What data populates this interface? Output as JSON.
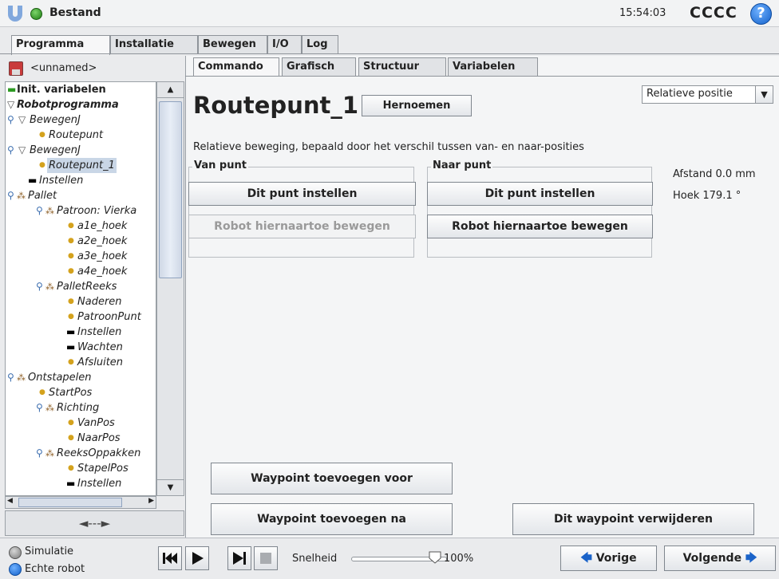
{
  "topbar": {
    "status": "Bestand",
    "clock": "15:54:03",
    "robot_name": "CCCC",
    "help": "?"
  },
  "main_tabs": [
    "Programma",
    "Installatie",
    "Bewegen",
    "I/O",
    "Log"
  ],
  "left": {
    "program_name": "<unnamed>",
    "tree": [
      {
        "label": "Init. variabelen"
      },
      {
        "label": "Robotprogramma"
      },
      {
        "label": "BewegenJ"
      },
      {
        "label": "Routepunt"
      },
      {
        "label": "BewegenJ"
      },
      {
        "label": "Routepunt_1"
      },
      {
        "label": "Instellen"
      },
      {
        "label": "Pallet"
      },
      {
        "label": "Patroon: Vierka"
      },
      {
        "label": "a1e_hoek"
      },
      {
        "label": "a2e_hoek"
      },
      {
        "label": "a3e_hoek"
      },
      {
        "label": "a4e_hoek"
      },
      {
        "label": "PalletReeks"
      },
      {
        "label": "Naderen"
      },
      {
        "label": "PatroonPunt"
      },
      {
        "label": "Instellen"
      },
      {
        "label": "Wachten"
      },
      {
        "label": "Afsluiten"
      },
      {
        "label": "Ontstapelen"
      },
      {
        "label": "StartPos"
      },
      {
        "label": "Richting"
      },
      {
        "label": "VanPos"
      },
      {
        "label": "NaarPos"
      },
      {
        "label": "ReeksOppakken"
      },
      {
        "label": "StapelPos"
      },
      {
        "label": "Instellen"
      }
    ],
    "nav_arrows": "◄---►"
  },
  "sub_tabs": [
    "Commando",
    "Grafisch",
    "Structuur",
    "Variabelen"
  ],
  "command": {
    "title": "Routepunt_1",
    "rename_label": "Hernoemen",
    "mode_value": "Relatieve positie",
    "description": "Relatieve beweging, bepaald door het verschil tussen van- en naar-posities",
    "from_group": "Van punt",
    "to_group": "Naar punt",
    "set_point_label": "Dit punt instellen",
    "move_here_label": "Robot hiernaartoe bewegen",
    "distance": "Afstand 0.0 mm",
    "angle": "Hoek 179.1 °",
    "add_before_label": "Waypoint toevoegen voor",
    "add_after_label": "Waypoint toevoegen na",
    "delete_label": "Dit waypoint verwijderen"
  },
  "bottom": {
    "simulation": "Simulatie",
    "real_robot": "Echte robot",
    "speed_label": "Snelheid",
    "speed_value": "100%",
    "speed_fraction": 1.0,
    "prev_label": "Vorige",
    "next_label": "Volgende"
  },
  "colors": {
    "accent_blue": "#1260c9",
    "status_green": "#2c9a22",
    "selection": "#c9d6e6"
  }
}
